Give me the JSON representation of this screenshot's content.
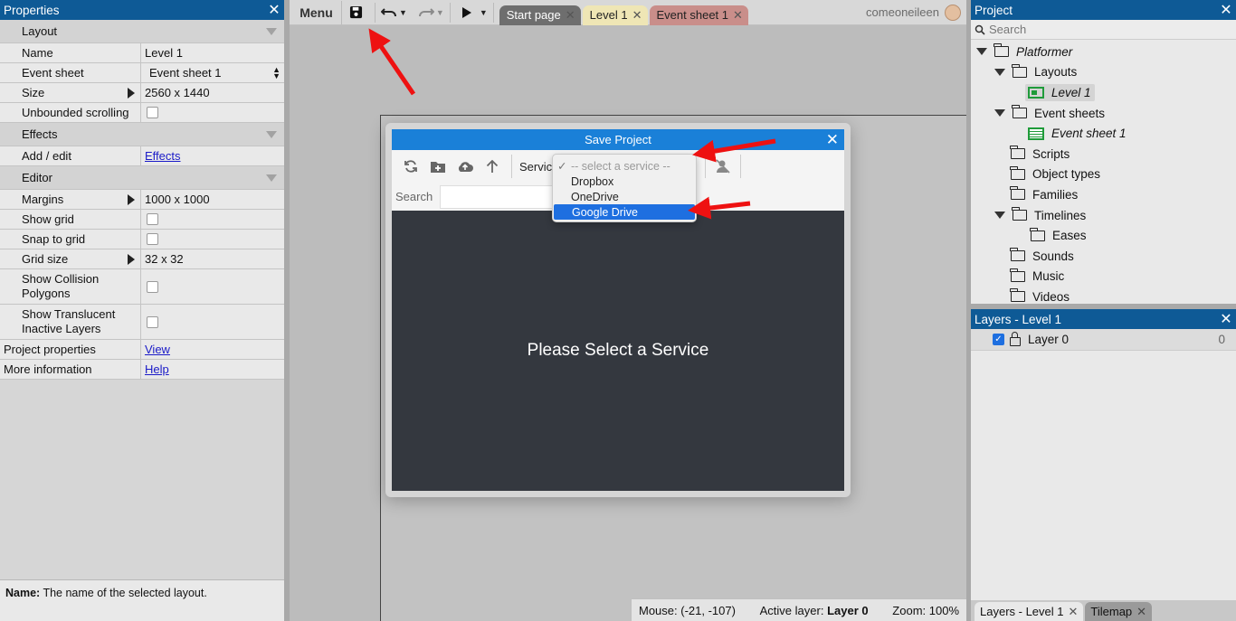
{
  "properties_panel": {
    "title": "Properties",
    "categories": {
      "layout": "Layout",
      "effects": "Effects",
      "editor": "Editor"
    },
    "rows": {
      "name": {
        "label": "Name",
        "value": "Level 1"
      },
      "event_sheet": {
        "label": "Event sheet",
        "value": "Event sheet 1"
      },
      "size": {
        "label": "Size",
        "value": "2560 x 1440"
      },
      "unbounded": {
        "label": "Unbounded scrolling"
      },
      "add_edit": {
        "label": "Add / edit",
        "value": "Effects"
      },
      "margins": {
        "label": "Margins",
        "value": "1000 x 1000"
      },
      "show_grid": {
        "label": "Show grid"
      },
      "snap_grid": {
        "label": "Snap to grid"
      },
      "grid_size": {
        "label": "Grid size",
        "value": "32 x 32"
      },
      "show_collision": {
        "label": "Show Collision Polygons"
      },
      "show_translucent": {
        "label": "Show Translucent Inactive Layers"
      },
      "project_props": {
        "label": "Project properties",
        "value": "View"
      },
      "more_info": {
        "label": "More information",
        "value": "Help"
      }
    },
    "info": {
      "bold": "Name:",
      "text": " The name of the selected layout."
    }
  },
  "toolbar": {
    "menu_label": "Menu",
    "user": "comeoneileen",
    "tabs": [
      {
        "label": "Start page",
        "color": "#6e6e6e",
        "text_color": "#ffffff"
      },
      {
        "label": "Level 1",
        "color": "#efe6b5",
        "text_color": "#222222"
      },
      {
        "label": "Event sheet 1",
        "color": "#c98e8a",
        "text_color": "#222222"
      }
    ]
  },
  "dialog": {
    "title": "Save Project",
    "service_label": "Service",
    "search_label": "Search",
    "body_message": "Please Select a Service",
    "service_options": [
      "-- select a service --",
      "Dropbox",
      "OneDrive",
      "Google Drive"
    ],
    "selected_option": "Google Drive"
  },
  "statusbar": {
    "mouse": "Mouse: (-21, -107)",
    "active_layer_label": "Active layer:",
    "active_layer_value": "Layer 0",
    "zoom": "Zoom: 100%"
  },
  "project_panel": {
    "title": "Project",
    "search_placeholder": "Search",
    "tree": {
      "root": "Platformer",
      "layouts": "Layouts",
      "level1": "Level 1",
      "event_sheets": "Event sheets",
      "event_sheet1": "Event sheet 1",
      "scripts": "Scripts",
      "object_types": "Object types",
      "families": "Families",
      "timelines": "Timelines",
      "eases": "Eases",
      "sounds": "Sounds",
      "music": "Music",
      "videos": "Videos"
    }
  },
  "layers_panel": {
    "title": "Layers - Level 1",
    "layer": {
      "name": "Layer 0",
      "index": "0"
    }
  },
  "bottom_tabs": [
    "Layers - Level 1",
    "Tilemap"
  ],
  "colors": {
    "panel_header": "#0e5a96",
    "dialog_header": "#1a80d8",
    "selection": "#1e6fe0",
    "annotation_arrow": "#ee1111"
  },
  "icons": [
    "save-icon",
    "undo-icon",
    "redo-icon",
    "play-icon",
    "refresh-icon",
    "new-folder-icon",
    "upload-icon",
    "up-arrow-icon",
    "sign-out-icon",
    "close-icon",
    "folder-icon",
    "search-icon",
    "lock-icon"
  ]
}
